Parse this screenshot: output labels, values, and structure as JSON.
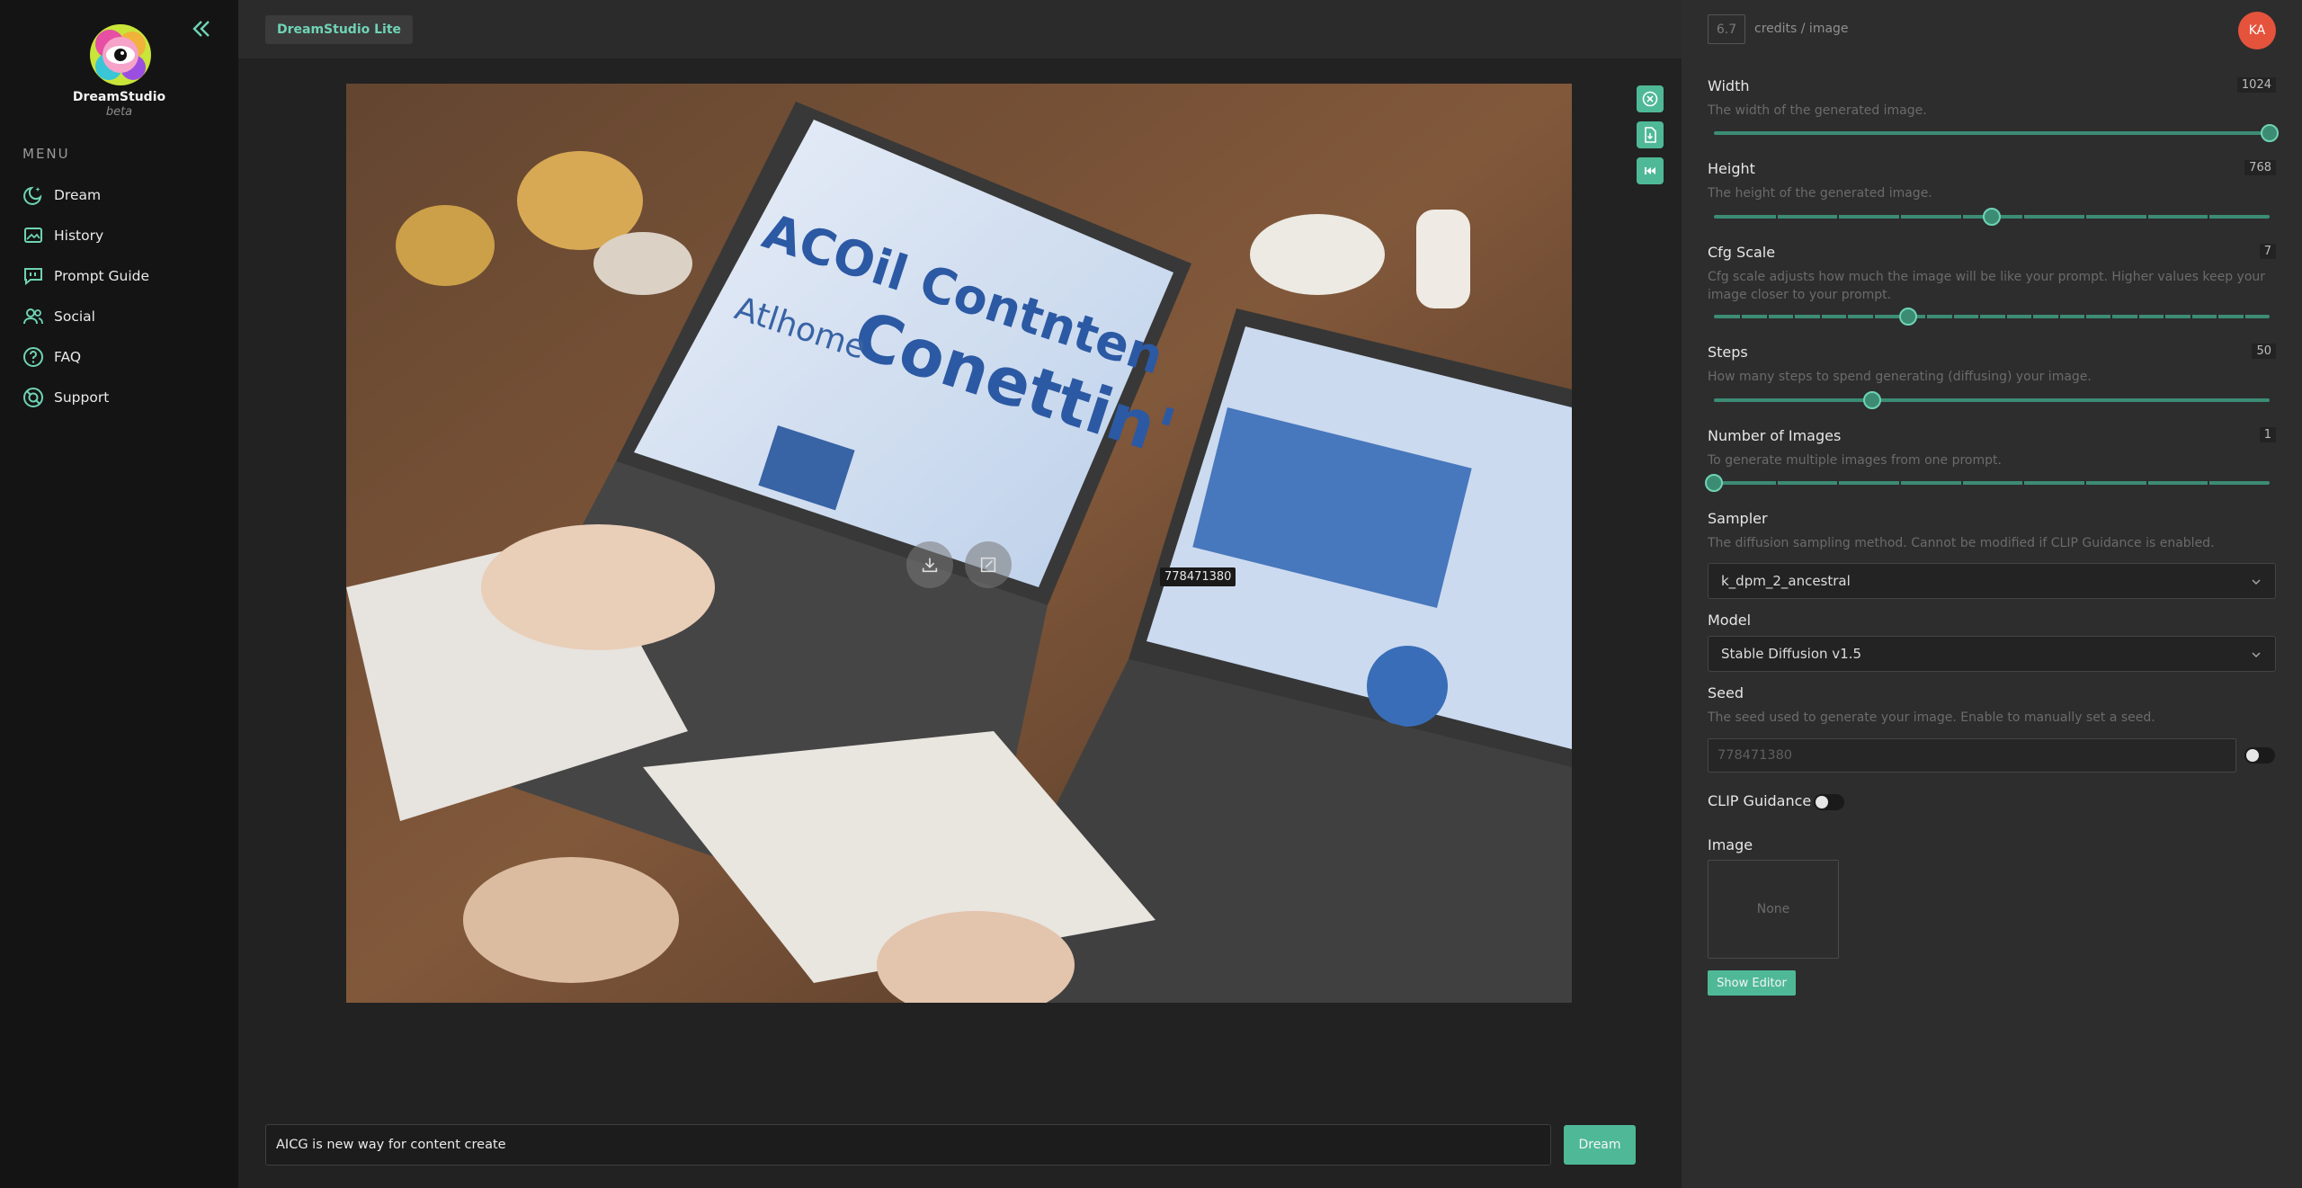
{
  "brand": {
    "name": "DreamStudio",
    "sub": "beta"
  },
  "sidebar": {
    "menu_label": "MENU",
    "items": [
      {
        "label": "Dream",
        "icon": "dream-icon"
      },
      {
        "label": "History",
        "icon": "history-icon"
      },
      {
        "label": "Prompt Guide",
        "icon": "prompt-guide-icon"
      },
      {
        "label": "Social",
        "icon": "social-icon"
      },
      {
        "label": "FAQ",
        "icon": "faq-icon"
      },
      {
        "label": "Support",
        "icon": "support-icon"
      }
    ]
  },
  "topbar": {
    "badge": "DreamStudio Lite"
  },
  "canvas": {
    "seed_label": "778471380"
  },
  "prompt": {
    "value": "AICG is new way for content create",
    "dream_label": "Dream"
  },
  "panel": {
    "credits_value": "6.7",
    "credits_label": "credits / image",
    "avatar": "KA",
    "width": {
      "label": "Width",
      "value": "1024",
      "desc": "The width of the generated image.",
      "fraction": 1.0
    },
    "height": {
      "label": "Height",
      "value": "768",
      "desc": "The height of the generated image.",
      "fraction": 0.5
    },
    "cfg": {
      "label": "Cfg Scale",
      "value": "7",
      "desc": "Cfg scale adjusts how much the image will be like your prompt. Higher values keep your image closer to your prompt.",
      "fraction": 0.35
    },
    "steps": {
      "label": "Steps",
      "value": "50",
      "desc": "How many steps to spend generating (diffusing) your image.",
      "fraction": 0.285
    },
    "num_images": {
      "label": "Number of Images",
      "value": "1",
      "desc": "To generate multiple images from one prompt.",
      "fraction": 0.0
    },
    "sampler": {
      "label": "Sampler",
      "desc": "The diffusion sampling method. Cannot be modified if CLIP Guidance is enabled.",
      "value": "k_dpm_2_ancestral"
    },
    "model": {
      "label": "Model",
      "value": "Stable Diffusion v1.5"
    },
    "seed": {
      "label": "Seed",
      "desc": "The seed used to generate your image. Enable to manually set a seed.",
      "placeholder": "778471380"
    },
    "clip": {
      "label": "CLIP Guidance"
    },
    "image": {
      "label": "Image",
      "placeholder": "None",
      "show_editor": "Show Editor"
    }
  },
  "colors": {
    "accent": "#4fb997",
    "accent_light": "#6fd3b4",
    "avatar": "#e5533d"
  }
}
